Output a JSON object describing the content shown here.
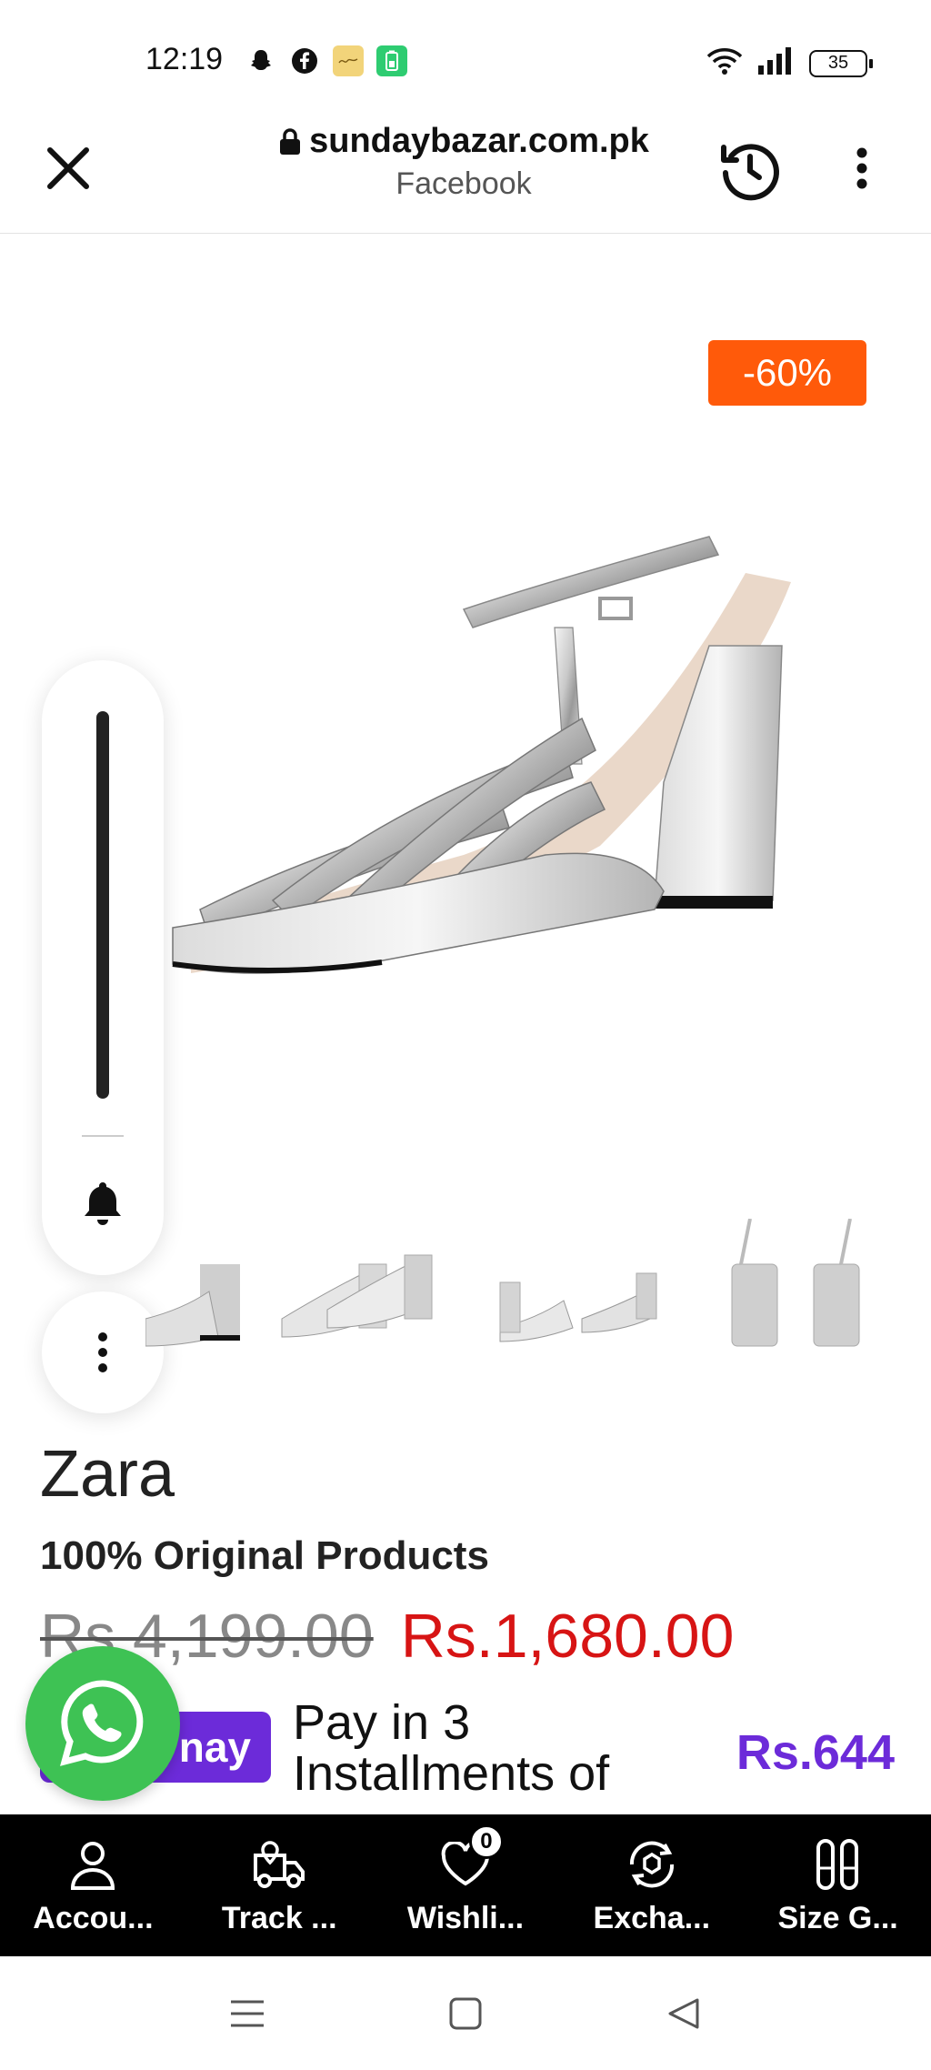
{
  "status": {
    "time": "12:19",
    "battery": "35",
    "icons_left": [
      "snapchat-icon",
      "facebook-icon",
      "notes-app-icon",
      "battery-app-icon"
    ],
    "icons_right": [
      "wifi-icon",
      "signal-icon",
      "battery-icon"
    ]
  },
  "browser": {
    "url": "sundaybazar.com.pk",
    "source": "Facebook"
  },
  "product": {
    "discount": "-60%",
    "brand": "Zara",
    "tagline": "100% Original Products",
    "old_price": "Rs.4,199.00",
    "new_price": "Rs.1,680.00",
    "installment_badge": "nay",
    "installment_text": "Pay in 3 Installments of",
    "installment_amount": "Rs.644"
  },
  "nav": {
    "items": [
      {
        "label": "Accou...",
        "icon": "user-icon"
      },
      {
        "label": "Track ...",
        "icon": "truck-icon"
      },
      {
        "label": "Wishli...",
        "icon": "heart-icon",
        "badge": "0"
      },
      {
        "label": "Excha...",
        "icon": "exchange-icon"
      },
      {
        "label": "Size G...",
        "icon": "footprint-icon"
      }
    ]
  },
  "colors": {
    "discount": "#ff5a0a",
    "sale_price": "#d71414",
    "bnpl": "#6c2bd9",
    "whatsapp": "#3ec254"
  }
}
